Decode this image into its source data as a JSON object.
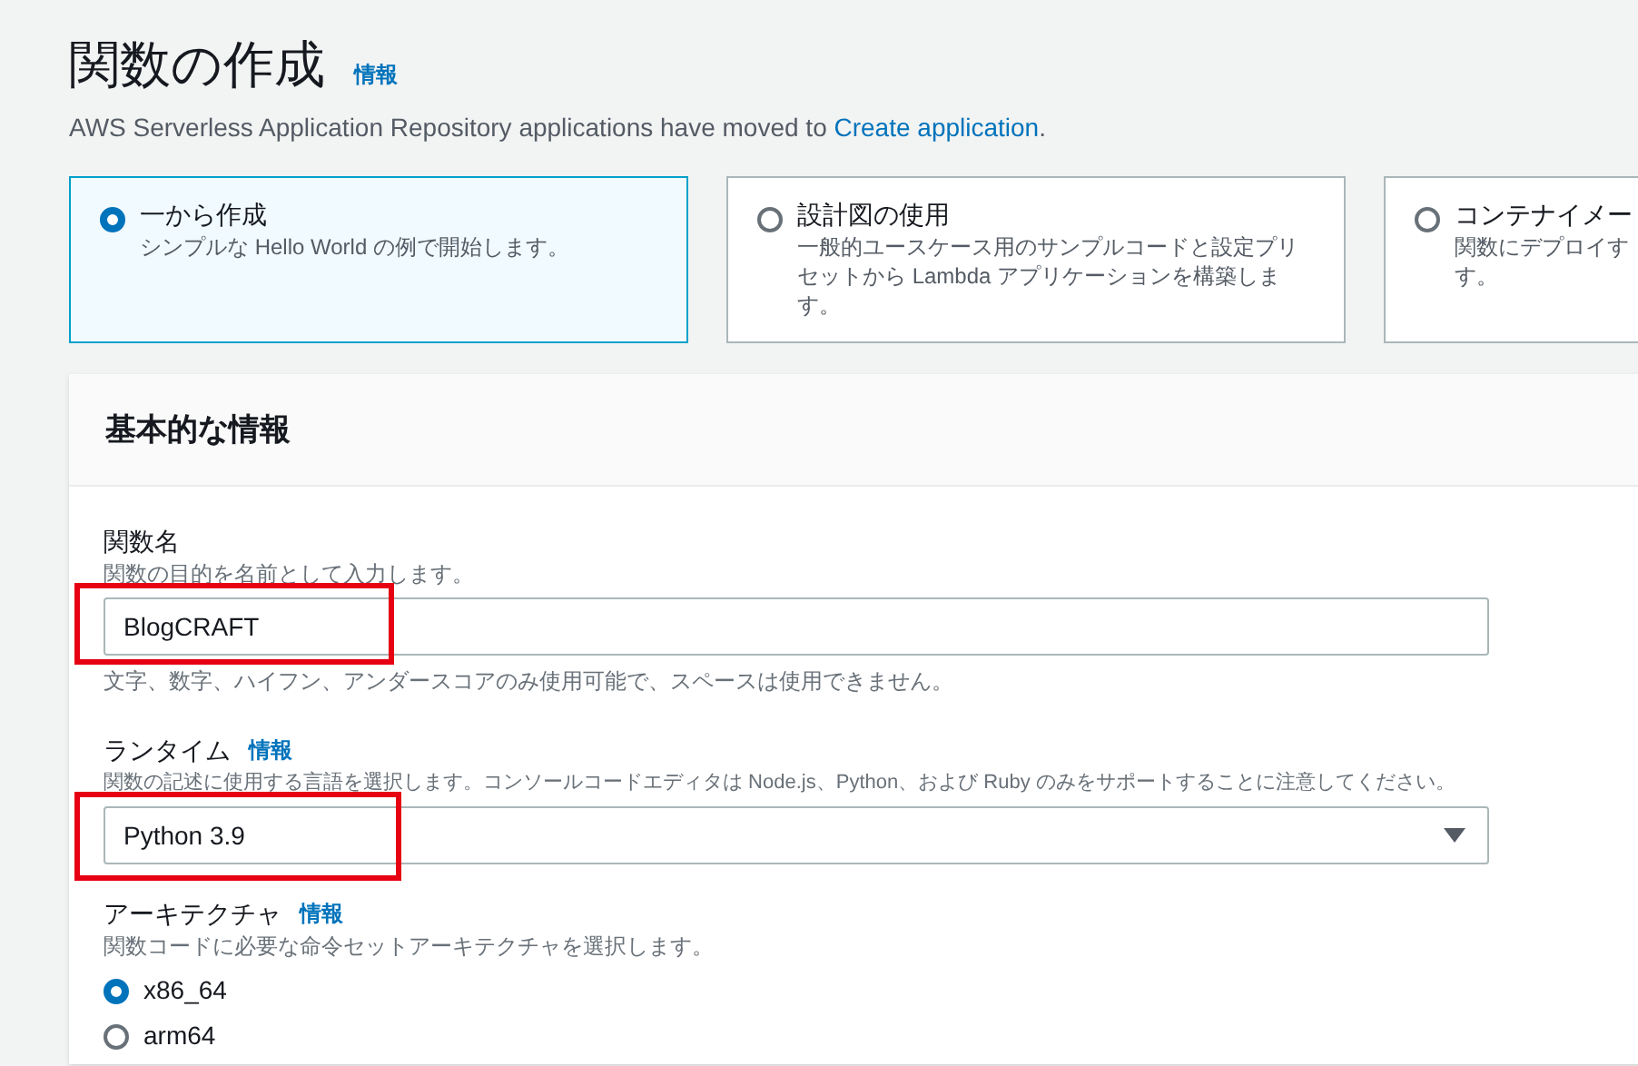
{
  "page": {
    "title": "関数の作成",
    "info_link": "情報",
    "notice": "AWS Serverless Application Repository applications have moved to ",
    "notice_link": "Create application",
    "notice_end": "."
  },
  "options": [
    {
      "title": "一から作成",
      "description": [
        "シンプルな Hello World の例で開始します。"
      ],
      "selected": true
    },
    {
      "title": "設計図の使用",
      "description": [
        "一般的ユースケース用のサンプルコードと設定プリ",
        "セットから Lambda アプリケーションを構築しま",
        "す。"
      ],
      "selected": false
    },
    {
      "title": "コンテナイメー",
      "description": [
        "関数にデプロイす",
        "す。"
      ],
      "selected": false
    }
  ],
  "panel": {
    "title": "基本的な情報",
    "function_name": {
      "label": "関数名",
      "hint": "関数の目的を名前として入力します。",
      "value": "BlogCRAFT",
      "constraint": "文字、数字、ハイフン、アンダースコアのみ使用可能で、スペースは使用できません。",
      "highlighted": true
    },
    "runtime": {
      "label": "ランタイム",
      "info_link": "情報",
      "hint": "関数の記述に使用する言語を選択します。コンソールコードエディタは Node.js、Python、および Ruby のみをサポートすることに注意してください。",
      "value": "Python 3.9",
      "highlighted": true
    },
    "architecture": {
      "label": "アーキテクチャ",
      "info_link": "情報",
      "hint": "関数コードに必要な命令セットアーキテクチャを選択します。",
      "choices": [
        {
          "label": "x86_64",
          "selected": true
        },
        {
          "label": "arm64",
          "selected": false
        }
      ]
    }
  }
}
